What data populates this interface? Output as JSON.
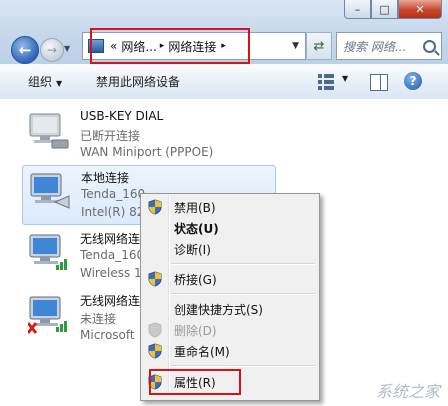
{
  "window": {
    "minimize_glyph": "–",
    "maximize_glyph": "□",
    "close_glyph": "✕"
  },
  "address": {
    "prefix": "«",
    "crumb_1": "网络...",
    "separator": "▸",
    "crumb_2": "网络连接",
    "drop_glyph": "▼"
  },
  "search": {
    "placeholder": "搜索 网络..."
  },
  "toolbar": {
    "organize_label": "组织",
    "disable_device_label": "禁用此网络设备",
    "help_glyph": "?"
  },
  "connections": [
    {
      "name": "USB-KEY DIAL",
      "status": "已断开连接",
      "device": "WAN Miniport (PPPOE)"
    },
    {
      "name": "本地连接",
      "status": "Tenda_160",
      "device": "Intel(R) 82"
    },
    {
      "name": "无线网络连",
      "status": "Tenda_160",
      "device": "Wireless 1"
    },
    {
      "name": "无线网络连",
      "status": "未连接",
      "device": "Microsoft"
    }
  ],
  "context_menu": {
    "disable": "禁用(B)",
    "status": "状态(U)",
    "diagnose": "诊断(I)",
    "bridge": "桥接(G)",
    "create_shortcut": "创建快捷方式(S)",
    "delete": "删除(D)",
    "rename": "重命名(M)",
    "properties": "属性(R)"
  },
  "watermark": "系统之家",
  "colors": {
    "highlight": "#d4141b",
    "selection": "#dbeafb",
    "accent": "#2f65b4"
  }
}
